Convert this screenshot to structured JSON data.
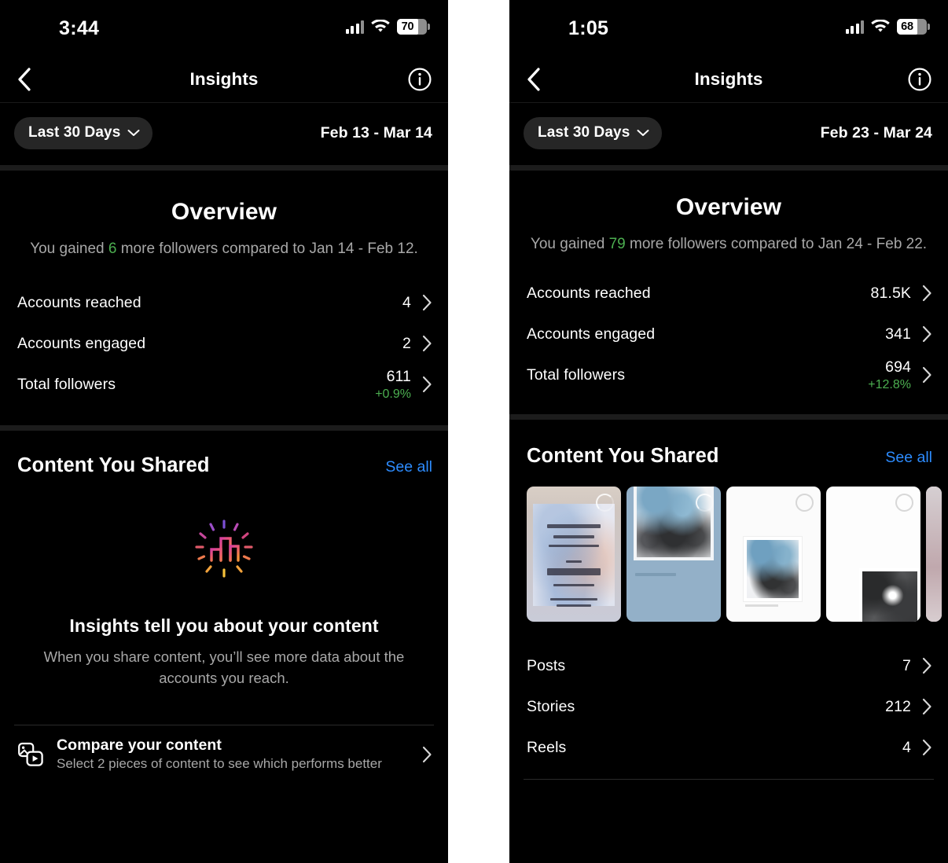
{
  "panels": [
    {
      "id": "left",
      "status": {
        "time": "3:44",
        "battery_pct": "70"
      },
      "nav": {
        "title": "Insights",
        "back_icon": "chevron-left-icon",
        "info_icon": "info-circle-icon"
      },
      "date": {
        "chip_label": "Last 30 Days",
        "chip_icon": "chevron-down-icon",
        "range": "Feb 13 - Mar 14"
      },
      "overview": {
        "title": "Overview",
        "summary_pre": "You gained ",
        "summary_highlight": "6",
        "summary_post": " more followers compared to Jan 14 - Feb 12.",
        "rows": [
          {
            "label": "Accounts reached",
            "value": "4",
            "delta": ""
          },
          {
            "label": "Accounts engaged",
            "value": "2",
            "delta": ""
          },
          {
            "label": "Total followers",
            "value": "611",
            "delta": "+0.9%"
          }
        ]
      },
      "content": {
        "title": "Content You Shared",
        "see_all": "See all",
        "empty_icon": "bar-chart-sparkle-icon",
        "empty_heading": "Insights tell you about your content",
        "empty_body": "When you share content, you’ll see more data about the accounts you reach."
      },
      "compare": {
        "icon": "compare-media-icon",
        "title": "Compare your content",
        "subtitle": "Select 2 pieces of content to see which performs better",
        "chevron": "chevron-right-icon"
      }
    },
    {
      "id": "right",
      "status": {
        "time": "1:05",
        "battery_pct": "68"
      },
      "nav": {
        "title": "Insights",
        "back_icon": "chevron-left-icon",
        "info_icon": "info-circle-icon"
      },
      "date": {
        "chip_label": "Last 30 Days",
        "chip_icon": "chevron-down-icon",
        "range": "Feb 23 - Mar 24"
      },
      "overview": {
        "title": "Overview",
        "summary_pre": "You gained ",
        "summary_highlight": "79",
        "summary_post": " more followers compared to Jan 24 - Feb 22.",
        "rows": [
          {
            "label": "Accounts reached",
            "value": "81.5K",
            "delta": ""
          },
          {
            "label": "Accounts engaged",
            "value": "341",
            "delta": ""
          },
          {
            "label": "Total followers",
            "value": "694",
            "delta": "+12.8%"
          }
        ]
      },
      "content": {
        "title": "Content You Shared",
        "see_all": "See all",
        "thumbnails": [
          {
            "name": "poster-contemporary-paintings",
            "badge": "loading-ring-icon"
          },
          {
            "name": "blue-card-artwork",
            "badge": "loading-ring-icon"
          },
          {
            "name": "white-framed-artwork",
            "badge": "loading-ring-icon"
          },
          {
            "name": "white-bw-photo",
            "badge": "loading-ring-icon"
          },
          {
            "name": "pink-partial",
            "badge": ""
          }
        ],
        "rows": [
          {
            "label": "Posts",
            "value": "7"
          },
          {
            "label": "Stories",
            "value": "212"
          },
          {
            "label": "Reels",
            "value": "4"
          }
        ]
      }
    }
  ],
  "colors": {
    "accent_link": "#2d8cff",
    "positive": "#4caf50",
    "chip_bg": "#262626",
    "background": "#000000",
    "muted_text": "#a8a8a8"
  }
}
